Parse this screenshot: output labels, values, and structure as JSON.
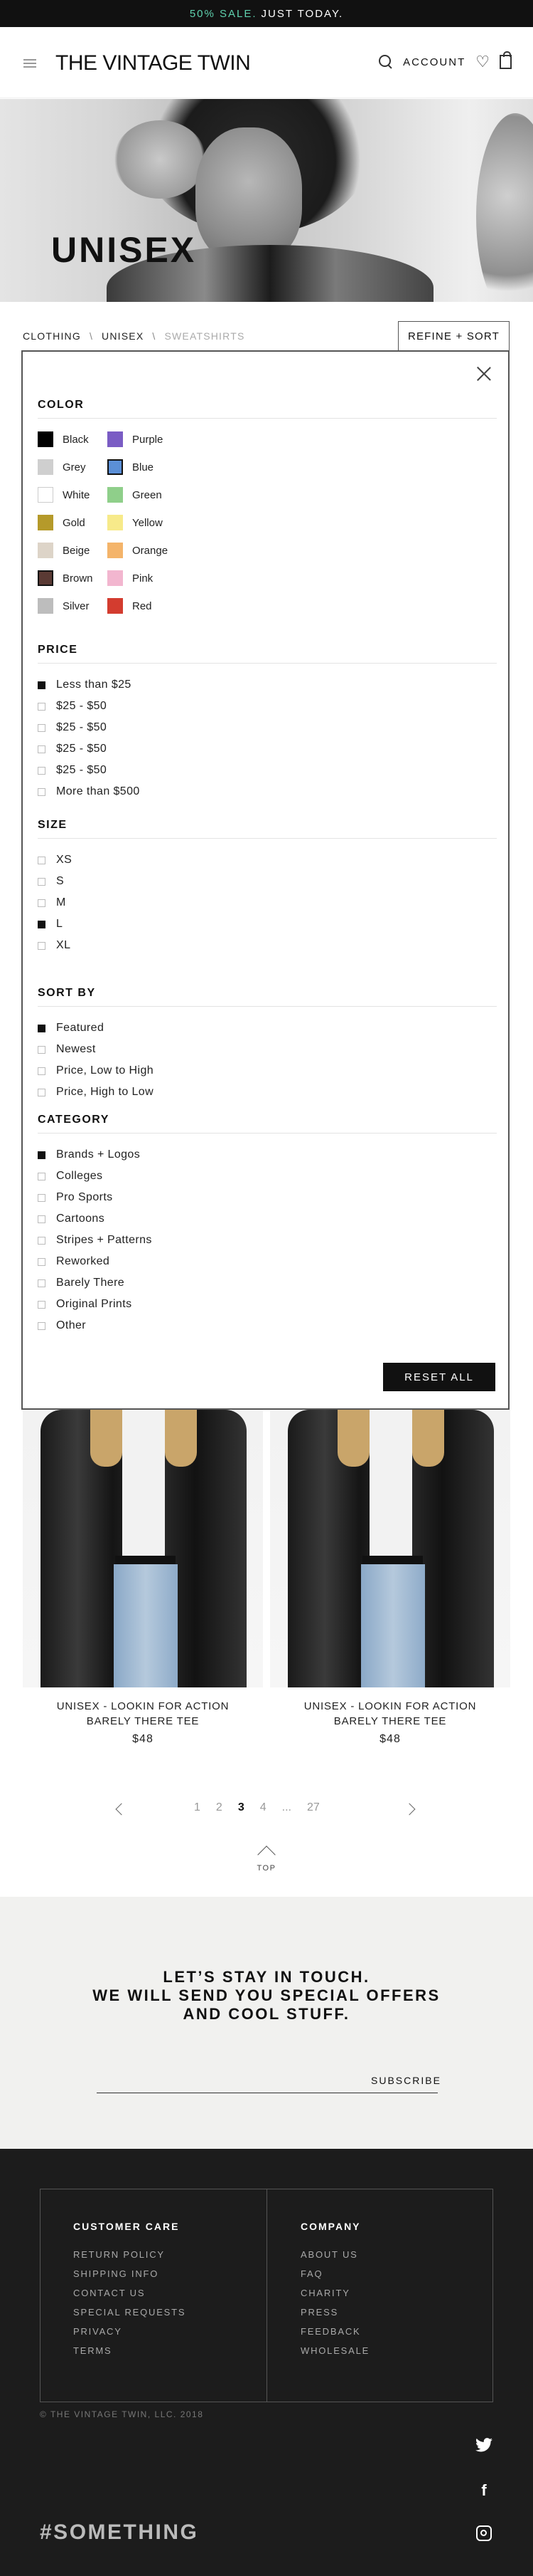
{
  "promo": {
    "highlight": "50% SALE.",
    "text": "JUST TODAY."
  },
  "header": {
    "logo": "THE VINTAGE TWIN",
    "account_label": "ACCOUNT"
  },
  "hero": {
    "title": "UNISEX"
  },
  "breadcrumb": {
    "items": [
      "CLOTHING",
      "UNISEX",
      "SWEATSHIRTS"
    ],
    "separator": "\\"
  },
  "refine_label": "REFINE + SORT",
  "filters": {
    "color": {
      "title": "COLOR",
      "items": [
        {
          "label": "Black",
          "color": "#000000"
        },
        {
          "label": "Purple",
          "color": "#7a5cc4"
        },
        {
          "label": "Grey",
          "color": "#cfcfcf"
        },
        {
          "label": "Blue",
          "color": "#5b8fd6"
        },
        {
          "label": "White",
          "color": "#ffffff"
        },
        {
          "label": "Green",
          "color": "#8fcf8a"
        },
        {
          "label": "Gold",
          "color": "#b59a2a"
        },
        {
          "label": "Yellow",
          "color": "#f7ea8a"
        },
        {
          "label": "Beige",
          "color": "#ddd4c8"
        },
        {
          "label": "Orange",
          "color": "#f4b46a"
        },
        {
          "label": "Brown",
          "color": "#5a3a34"
        },
        {
          "label": "Pink",
          "color": "#f2b6cf"
        },
        {
          "label": "Silver",
          "color": "#bdbdbd"
        },
        {
          "label": "Red",
          "color": "#d33c2f"
        }
      ]
    },
    "price": {
      "title": "PRICE",
      "items": [
        {
          "label": "Less than $25",
          "checked": true
        },
        {
          "label": "$25 - $50",
          "checked": false
        },
        {
          "label": "$25 - $50",
          "checked": false
        },
        {
          "label": "$25 - $50",
          "checked": false
        },
        {
          "label": "$25 - $50",
          "checked": false
        },
        {
          "label": "More than $500",
          "checked": false
        }
      ]
    },
    "size": {
      "title": "SIZE",
      "items": [
        {
          "label": "XS",
          "checked": false
        },
        {
          "label": "S",
          "checked": false
        },
        {
          "label": "M",
          "checked": false
        },
        {
          "label": "L",
          "checked": true
        },
        {
          "label": "XL",
          "checked": false
        }
      ]
    },
    "sort": {
      "title": "SORT BY",
      "items": [
        {
          "label": "Featured",
          "checked": true
        },
        {
          "label": "Newest",
          "checked": false
        },
        {
          "label": "Price, Low to High",
          "checked": false
        },
        {
          "label": "Price, High to Low",
          "checked": false
        }
      ]
    },
    "category": {
      "title": "CATEGORY",
      "items": [
        {
          "label": "Brands + Logos",
          "checked": true
        },
        {
          "label": "Colleges",
          "checked": false
        },
        {
          "label": "Pro Sports",
          "checked": false
        },
        {
          "label": "Cartoons",
          "checked": false
        },
        {
          "label": "Stripes + Patterns",
          "checked": false
        },
        {
          "label": "Reworked",
          "checked": false
        },
        {
          "label": "Barely There",
          "checked": false
        },
        {
          "label": "Original Prints",
          "checked": false
        },
        {
          "label": "Other",
          "checked": false
        }
      ]
    },
    "reset_label": "RESET ALL"
  },
  "products": [
    {
      "name_line1": "UNISEX - LOOKIN FOR ACTION",
      "name_line2": "BARELY THERE TEE",
      "price": "$48"
    },
    {
      "name_line1": "UNISEX - LOOKIN FOR ACTION",
      "name_line2": "BARELY THERE TEE",
      "price": "$48"
    }
  ],
  "pagination": {
    "pages": [
      "1",
      "2",
      "3",
      "4",
      "...",
      "27"
    ],
    "current": "3"
  },
  "top_label": "TOP",
  "newsletter": {
    "line1": "LET’S STAY IN TOUCH.",
    "line2": "WE WILL SEND YOU SPECIAL OFFERS",
    "line3": "AND COOL STUFF.",
    "subscribe_label": "SUBSCRIBE"
  },
  "footer": {
    "customer_care": {
      "title": "CUSTOMER CARE",
      "links": [
        "RETURN POLICY",
        "SHIPPING INFO",
        "CONTACT US",
        "SPECIAL REQUESTS",
        "PRIVACY",
        "TERMS"
      ]
    },
    "company": {
      "title": "COMPANY",
      "links": [
        "ABOUT US",
        "FAQ",
        "CHARITY",
        "PRESS",
        "FEEDBACK",
        "WHOLESALE"
      ]
    },
    "copyright": "© THE VINTAGE TWIN, LLC. 2018",
    "social_icons": [
      "twitter-icon",
      "facebook-icon",
      "instagram-icon"
    ],
    "hashtag": "#SOMETHING"
  }
}
